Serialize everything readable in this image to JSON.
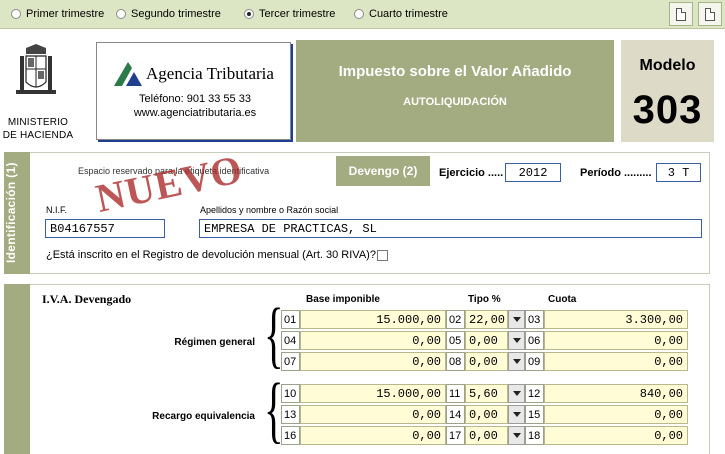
{
  "periods": {
    "options": [
      "Primer trimestre",
      "Segundo  trimestre",
      "Tercer trimestre",
      "Cuarto trimestre"
    ],
    "selected_index": 2
  },
  "header": {
    "ministry_line1": "MINISTERIO",
    "ministry_line2": "DE HACIENDA",
    "agency_name": "Agencia Tributaria",
    "agency_phone": "Teléfono:  901 33 55 33",
    "agency_web": "www.agenciatributaria.es",
    "tax_title": "Impuesto sobre el Valor Añadido",
    "tax_subtitle": "AUTOLIQUIDACIÓN",
    "model_label": "Modelo",
    "model_number": "303"
  },
  "identification": {
    "section_label": "Identificación (1)",
    "reserved_text": "Espacio reservado para la etiqueta identificativa",
    "stamp": "NUEVO",
    "devengo_label": "Devengo (2)",
    "ejercicio_label": "Ejercicio .....",
    "ejercicio_value": "2012",
    "periodo_label": "Período .........",
    "periodo_value": "3 T",
    "nif_label": "N.I.F.",
    "nif_value": "B04167557",
    "name_label": "Apellidos y nombre o Razón social",
    "name_value": "EMPRESA DE PRACTICAS, SL",
    "registro_question": "¿Está inscrito en el Registro de devolución mensual (Art. 30 RIVA)?",
    "registro_checked": false
  },
  "iva": {
    "title": "I.V.A. Devengado",
    "headers": {
      "base": "Base imponible",
      "tipo": "Tipo %",
      "cuota": "Cuota"
    },
    "groups": [
      {
        "label": "Régimen general",
        "rows": [
          {
            "n_base": "01",
            "base": "15.000,00",
            "n_tipo": "02",
            "tipo": "22,00",
            "n_cuota": "03",
            "cuota": "3.300,00"
          },
          {
            "n_base": "04",
            "base": "0,00",
            "n_tipo": "05",
            "tipo": "0,00",
            "n_cuota": "06",
            "cuota": "0,00"
          },
          {
            "n_base": "07",
            "base": "0,00",
            "n_tipo": "08",
            "tipo": "0,00",
            "n_cuota": "09",
            "cuota": "0,00"
          }
        ]
      },
      {
        "label": "Recargo equivalencia",
        "rows": [
          {
            "n_base": "10",
            "base": "15.000,00",
            "n_tipo": "11",
            "tipo": "5,60",
            "n_cuota": "12",
            "cuota": "840,00"
          },
          {
            "n_base": "13",
            "base": "0,00",
            "n_tipo": "14",
            "tipo": "0,00",
            "n_cuota": "15",
            "cuota": "0,00"
          },
          {
            "n_base": "16",
            "base": "0,00",
            "n_tipo": "17",
            "tipo": "0,00",
            "n_cuota": "18",
            "cuota": "0,00"
          }
        ]
      }
    ]
  },
  "toolbar": {
    "icons": [
      "new-document-icon",
      "copy-document-icon"
    ]
  },
  "colors": {
    "olive": "#a3ab80",
    "topbar": "#dde6c4",
    "cell": "#fffcd6",
    "field_border": "#3a5ea6"
  }
}
